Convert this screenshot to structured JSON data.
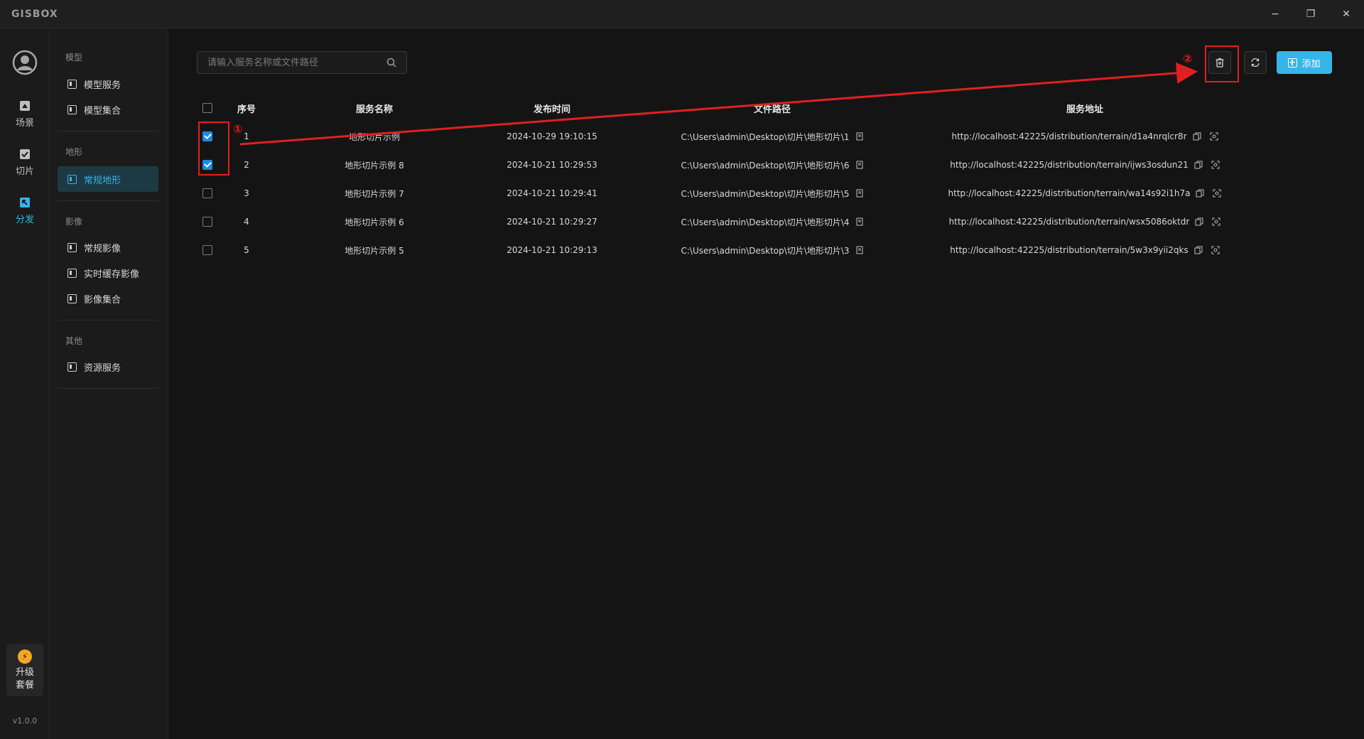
{
  "app": {
    "logo": "GISBOX",
    "version": "v1.0.0"
  },
  "window": {
    "minimize": "−",
    "restore": "❐",
    "close": "✕"
  },
  "rail": {
    "items": [
      {
        "label": "场景",
        "icon": "scene-icon"
      },
      {
        "label": "切片",
        "icon": "slice-icon"
      },
      {
        "label": "分发",
        "icon": "distribute-icon",
        "active": true
      }
    ],
    "upgrade": {
      "line1": "升级",
      "line2": "套餐",
      "icon": "lightning-icon",
      "glyph": "⚡"
    }
  },
  "nav": {
    "groups": [
      {
        "title": "模型",
        "items": [
          "模型服务",
          "模型集合"
        ]
      },
      {
        "title": "地形",
        "items": [
          "常规地形"
        ]
      },
      {
        "title": "影像",
        "items": [
          "常规影像",
          "实时缓存影像",
          "影像集合"
        ]
      },
      {
        "title": "其他",
        "items": [
          "资源服务"
        ]
      }
    ],
    "active": "常规地形"
  },
  "toolbar": {
    "search_placeholder": "请输入服务名称或文件路径",
    "add_label": "添加"
  },
  "table": {
    "columns": [
      "序号",
      "服务名称",
      "发布时间",
      "文件路径",
      "服务地址"
    ],
    "rows": [
      {
        "checked": true,
        "index": "1",
        "name": "地形切片示例",
        "time": "2024-10-29 19:10:15",
        "path": "C:\\Users\\admin\\Desktop\\切片\\地形切片\\1",
        "url": "http://localhost:42225/distribution/terrain/d1a4nrqlcr8r"
      },
      {
        "checked": true,
        "index": "2",
        "name": "地形切片示例 8",
        "time": "2024-10-21 10:29:53",
        "path": "C:\\Users\\admin\\Desktop\\切片\\地形切片\\6",
        "url": "http://localhost:42225/distribution/terrain/ijws3osdun21"
      },
      {
        "checked": false,
        "index": "3",
        "name": "地形切片示例 7",
        "time": "2024-10-21 10:29:41",
        "path": "C:\\Users\\admin\\Desktop\\切片\\地形切片\\5",
        "url": "http://localhost:42225/distribution/terrain/wa14s92i1h7a"
      },
      {
        "checked": false,
        "index": "4",
        "name": "地形切片示例 6",
        "time": "2024-10-21 10:29:27",
        "path": "C:\\Users\\admin\\Desktop\\切片\\地形切片\\4",
        "url": "http://localhost:42225/distribution/terrain/wsx5086oktdr"
      },
      {
        "checked": false,
        "index": "5",
        "name": "地形切片示例 5",
        "time": "2024-10-21 10:29:13",
        "path": "C:\\Users\\admin\\Desktop\\切片\\地形切片\\3",
        "url": "http://localhost:42225/distribution/terrain/5w3x9yii2qks"
      }
    ]
  },
  "annotations": {
    "step1": "①",
    "step2": "②",
    "color": "#e02020"
  },
  "colors": {
    "accent": "#36b5e8",
    "checkbox": "#1e88e5",
    "background": "#141414"
  }
}
